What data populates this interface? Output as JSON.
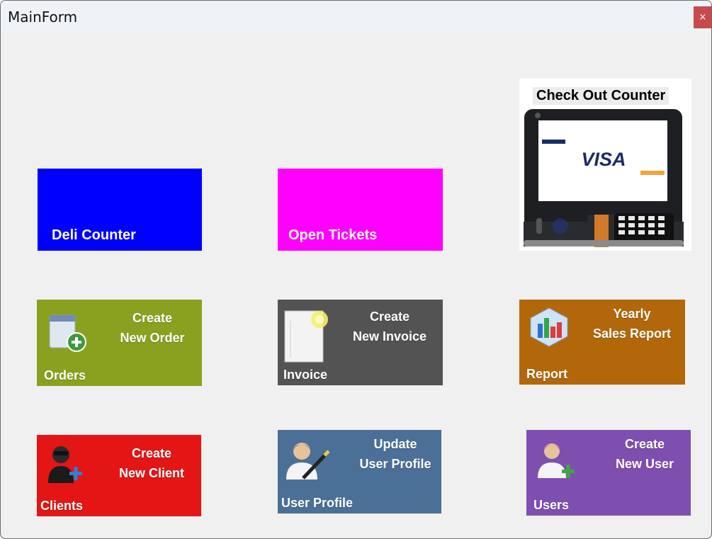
{
  "window": {
    "title": "MainForm",
    "close_label": "×"
  },
  "tiles": {
    "deli": {
      "label": "Deli Counter",
      "color": "#0000ff"
    },
    "open_tickets": {
      "label": "Open Tickets",
      "color": "#ff00ff"
    },
    "checkout": {
      "label": "Check Out Counter",
      "card_brand": "VISA"
    },
    "orders": {
      "name": "Orders",
      "desc_line1": "Create",
      "desc_line2": "New Order",
      "icon": "notepad-add-icon",
      "color": "#8aa11f"
    },
    "invoice": {
      "name": "Invoice",
      "desc_line1": "Create",
      "desc_line2": "New Invoice",
      "icon": "document-icon",
      "color": "#535353"
    },
    "report": {
      "name": "Report",
      "desc_line1": "Yearly",
      "desc_line2": "Sales Report",
      "icon": "bar-chart-icon",
      "color": "#b2670a"
    },
    "clients": {
      "name": "Clients",
      "desc_line1": "Create",
      "desc_line2": "New Client",
      "icon": "client-add-icon",
      "color": "#e41515"
    },
    "user_profile": {
      "name": "User Profile",
      "desc_line1": "Update",
      "desc_line2": "User Profile",
      "icon": "user-edit-icon",
      "color": "#4a7098"
    },
    "users": {
      "name": "Users",
      "desc_line1": "Create",
      "desc_line2": "New User",
      "icon": "user-add-icon",
      "color": "#7f4fb0"
    }
  }
}
